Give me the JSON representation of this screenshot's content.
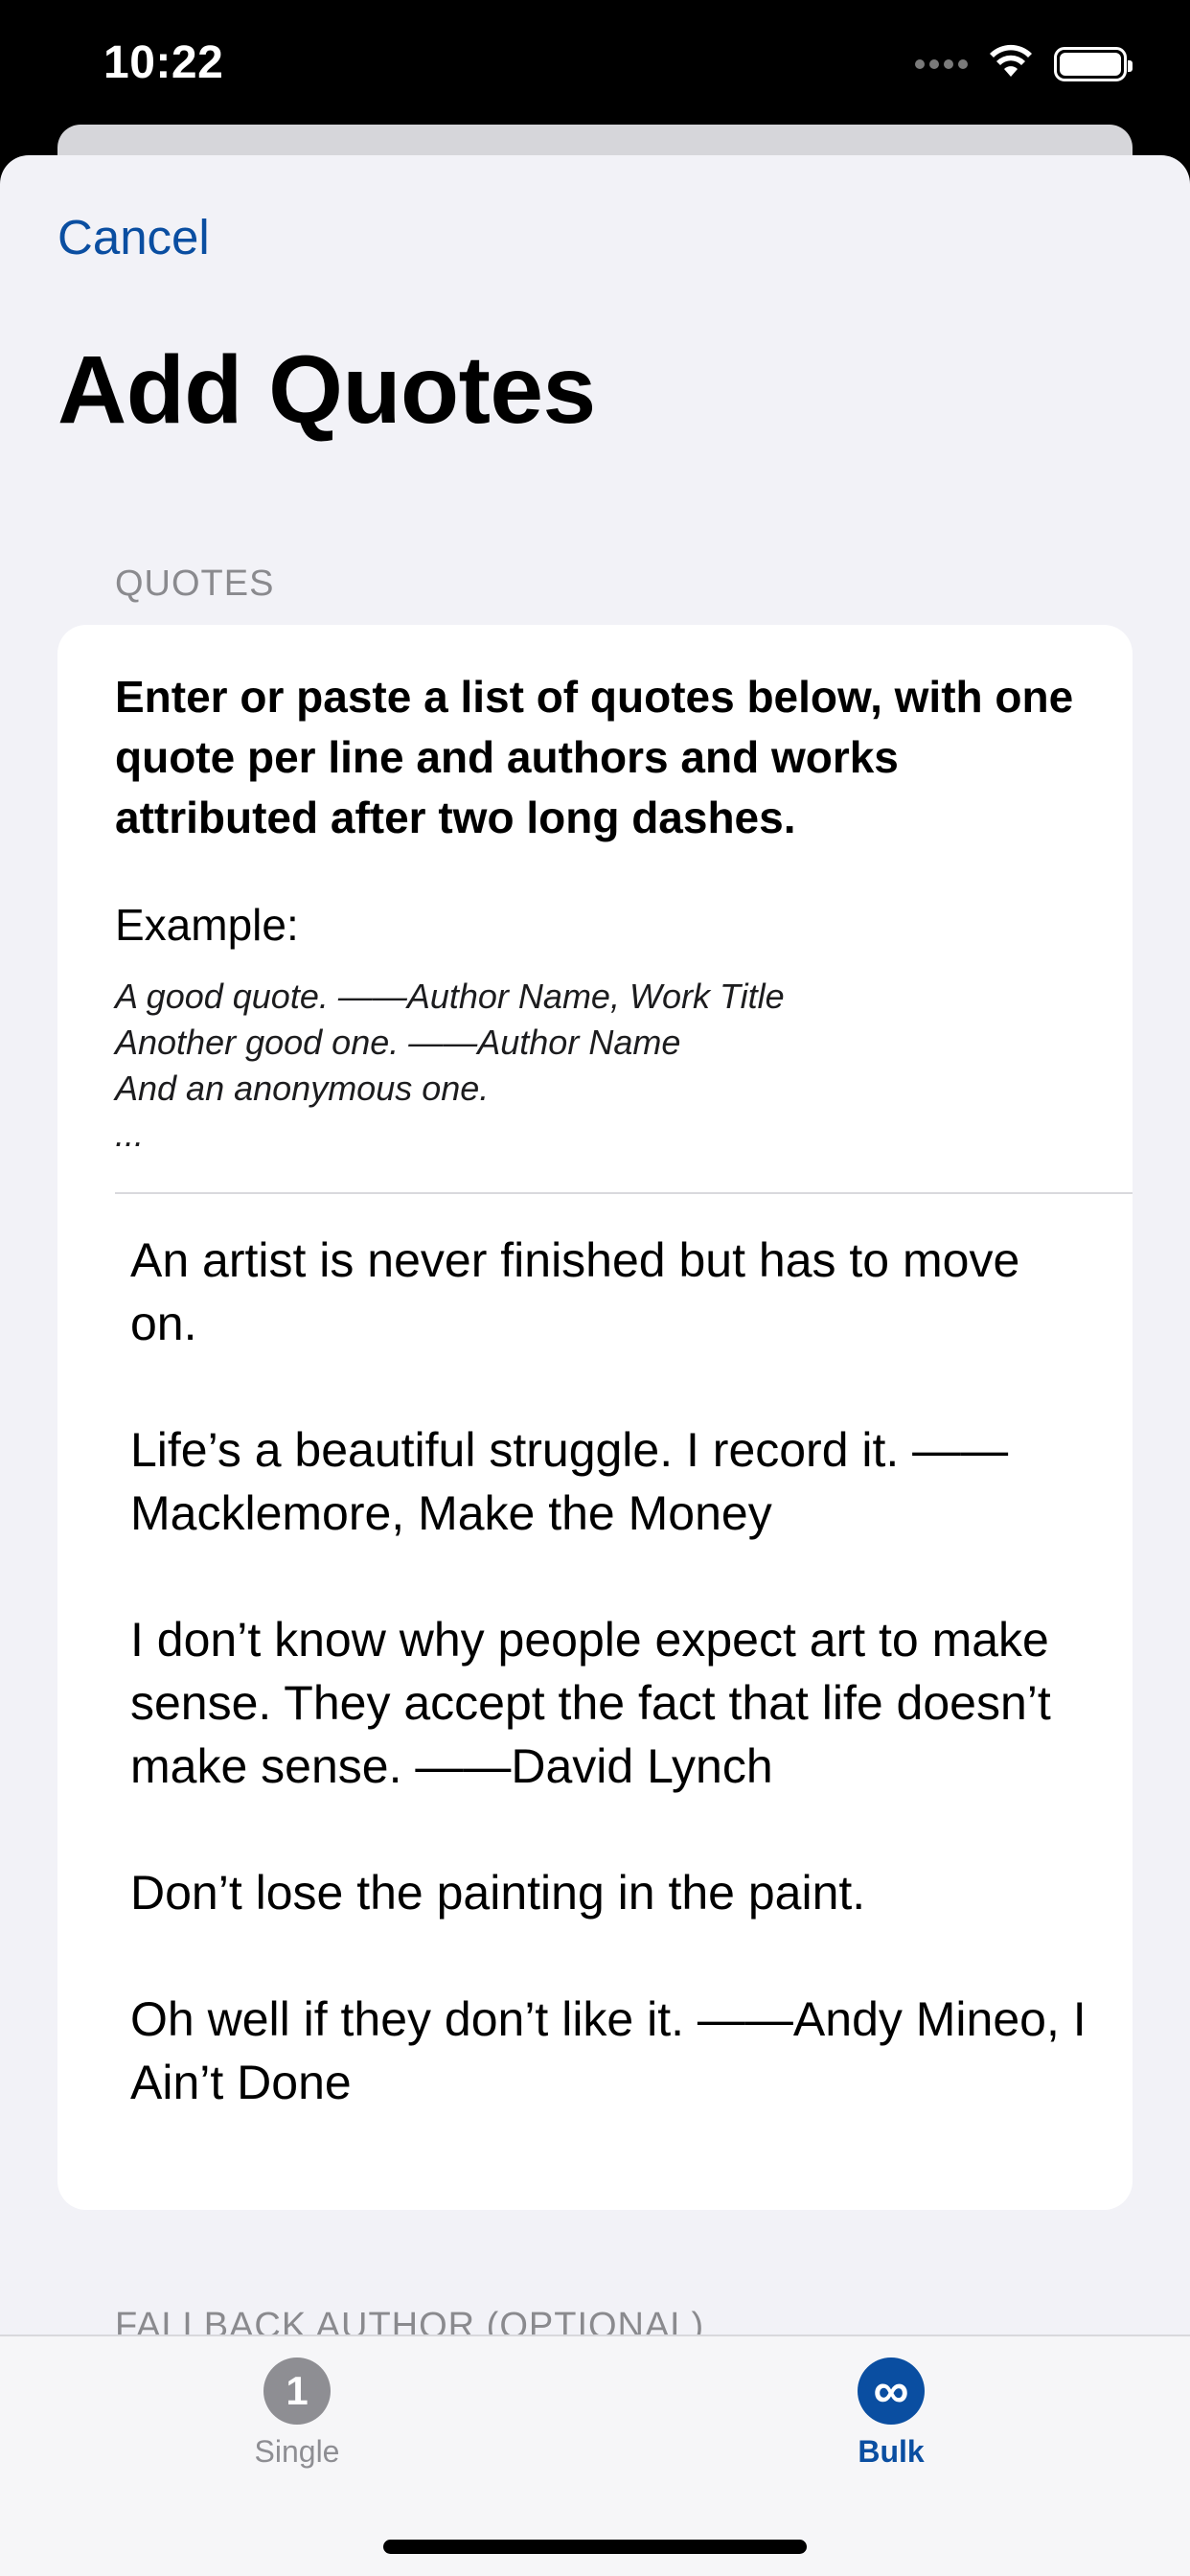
{
  "status_bar": {
    "time": "10:22",
    "icons": [
      "signal-icon",
      "wifi-icon",
      "battery-icon"
    ]
  },
  "nav": {
    "cancel_label": "Cancel",
    "title": "Add Quotes"
  },
  "quotes_section": {
    "header": "QUOTES",
    "instructions": "Enter or paste a list of quotes below, with one quote per line and authors and works attributed after two long dashes.",
    "example_label": "Example:",
    "example_lines": [
      "A good quote. ——Author Name, Work Title",
      "Another good one. ——Author Name",
      "And an anonymous one.",
      "..."
    ],
    "entries": [
      "An artist is never finished but has to move on.",
      "Life’s a beautiful struggle. I record it. ——Macklemore, Make the Money",
      "I don’t know why people expect art to make sense. They accept the fact that life doesn’t make sense. ——David Lynch",
      "Don’t lose the painting in the paint.",
      "Oh well if they don’t like it. ——Andy Mineo, I Ain’t Done"
    ]
  },
  "fallback_section": {
    "header": "FALLBACK AUTHOR (OPTIONAL)"
  },
  "tab_bar": {
    "tabs": [
      {
        "icon_text": "1",
        "label": "Single",
        "selected": false
      },
      {
        "icon_text": "∞",
        "label": "Bulk",
        "selected": true
      }
    ]
  },
  "colors": {
    "accent": "#0a4ea1",
    "background": "#f2f2f7",
    "card": "#ffffff",
    "secondary_text": "#8a8a8e"
  }
}
